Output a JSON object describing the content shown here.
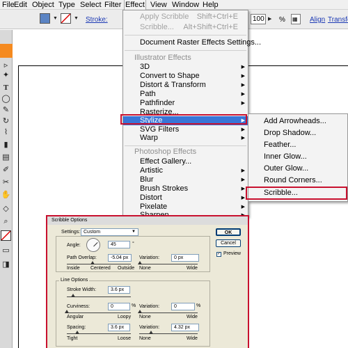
{
  "menubar": {
    "items": [
      {
        "label": "File"
      },
      {
        "label": "Edit"
      },
      {
        "label": "Object"
      },
      {
        "label": "Type"
      },
      {
        "label": "Select"
      },
      {
        "label": "Filter"
      },
      {
        "label": "Effect"
      },
      {
        "label": "View"
      },
      {
        "label": "Window"
      },
      {
        "label": "Help"
      }
    ]
  },
  "control_bar": {
    "fill_color": "#5b84c4",
    "stroke_label": "Stroke:",
    "opacity_value": "100",
    "opacity_unit": "%",
    "align_label": "Align",
    "transform_label": "Transform"
  },
  "effect_menu": {
    "apply_label": "Apply Scribble",
    "apply_shortcut": "Shift+Ctrl+E",
    "last_label": "Scribble...",
    "last_shortcut": "Alt+Shift+Ctrl+E",
    "doc_raster": "Document Raster Effects Settings...",
    "illustrator_header": "Illustrator Effects",
    "illustrator_items": [
      "3D",
      "Convert to Shape",
      "Distort & Transform",
      "Path",
      "Pathfinder",
      "Rasterize...",
      "Stylize",
      "SVG Filters",
      "Warp"
    ],
    "photoshop_header": "Photoshop Effects",
    "photoshop_items": [
      "Effect Gallery...",
      "Artistic",
      "Blur",
      "Brush Strokes",
      "Distort",
      "Pixelate",
      "Sharpen"
    ]
  },
  "stylize_menu": {
    "items": [
      "Add Arrowheads...",
      "Drop Shadow...",
      "Feather...",
      "Inner Glow...",
      "Outer Glow...",
      "Round Corners...",
      "Scribble..."
    ]
  },
  "scribble_dialog": {
    "title": "Scribble Options",
    "settings_label": "Settings:",
    "settings_value": "Custom",
    "ok_label": "OK",
    "cancel_label": "Cancel",
    "preview_label": "Preview",
    "preview_checked": true,
    "angle_label": "Angle:",
    "angle_value": "45",
    "angle_unit": "°",
    "path_overlap_label": "Path Overlap:",
    "path_overlap_value": "-5.04 px",
    "path_overlap_ticks": [
      "Inside",
      "Centered",
      "Outside"
    ],
    "overlap_variation_label": "Variation:",
    "overlap_variation_value": "0 px",
    "overlap_variation_ticks": [
      "None",
      "Wide"
    ],
    "line_options_label": "Line Options",
    "stroke_width_label": "Stroke Width:",
    "stroke_width_value": "3.6 px",
    "curviness_label": "Curviness:",
    "curviness_value": "0",
    "curviness_unit": "%",
    "curviness_ticks": [
      "Angular",
      "Loopy"
    ],
    "curviness_variation_label": "Variation:",
    "curviness_variation_value": "0",
    "curviness_variation_unit": "%",
    "curviness_variation_ticks": [
      "None",
      "Wide"
    ],
    "spacing_label": "Spacing:",
    "spacing_value": "3.6 px",
    "spacing_ticks": [
      "Tight",
      "Loose"
    ],
    "spacing_variation_label": "Variation:",
    "spacing_variation_value": "4.32 px",
    "spacing_variation_ticks": [
      "None",
      "Wide"
    ]
  },
  "colors": {
    "highlight_red": "#c8102e",
    "menu_selected": "#3875d7",
    "toolbar_orange": "#f58a1f"
  }
}
